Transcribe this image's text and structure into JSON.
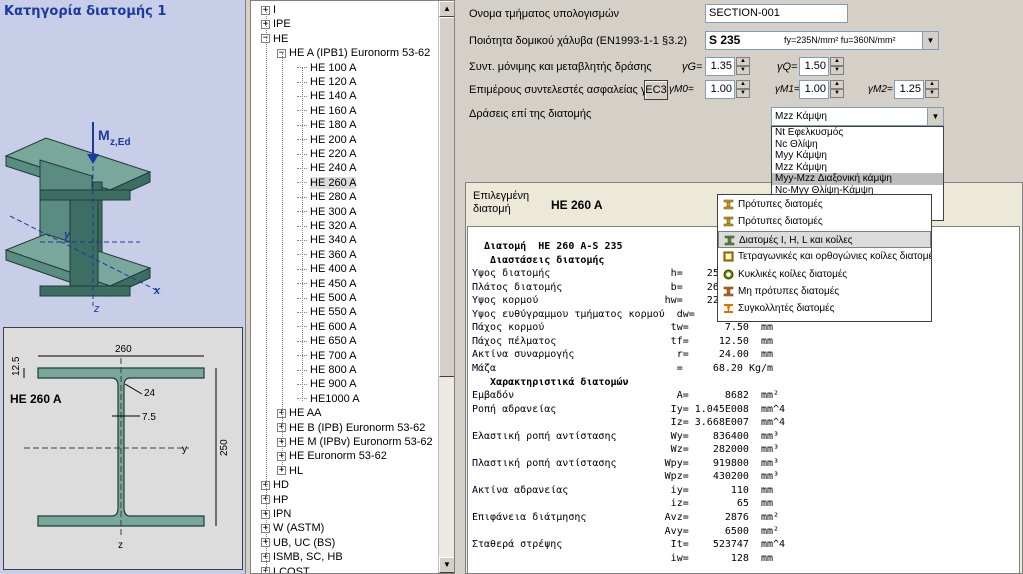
{
  "left": {
    "title": "Κατηγορία διατομής 1",
    "figure_labels": {
      "moment": "M",
      "moment_sub": "z,Ed",
      "y": "y",
      "z": "z",
      "x": "x"
    },
    "section": {
      "name": "HE 260 A",
      "width": "260",
      "height": "250",
      "flange": "12.5",
      "radius": "24",
      "web": "7.5",
      "y": "y",
      "z": "z"
    }
  },
  "tree": {
    "nodes": [
      {
        "label": "I",
        "level": 0,
        "box": "+"
      },
      {
        "label": "IPE",
        "level": 0,
        "box": "+"
      },
      {
        "label": "HE",
        "level": 0,
        "box": "−"
      },
      {
        "label": "HE A (IPB1)  Euronorm 53-62",
        "level": 1,
        "box": "−"
      },
      {
        "label": "HE 100 A",
        "level": 2
      },
      {
        "label": "HE 120 A",
        "level": 2
      },
      {
        "label": "HE 140 A",
        "level": 2
      },
      {
        "label": "HE 160 A",
        "level": 2
      },
      {
        "label": "HE 180 A",
        "level": 2
      },
      {
        "label": "HE 200 A",
        "level": 2
      },
      {
        "label": "HE 220 A",
        "level": 2
      },
      {
        "label": "HE 240 A",
        "level": 2
      },
      {
        "label": "HE 260 A",
        "level": 2,
        "selected": true
      },
      {
        "label": "HE 280 A",
        "level": 2
      },
      {
        "label": "HE 300 A",
        "level": 2
      },
      {
        "label": "HE 320 A",
        "level": 2
      },
      {
        "label": "HE 340 A",
        "level": 2
      },
      {
        "label": "HE 360 A",
        "level": 2
      },
      {
        "label": "HE 400 A",
        "level": 2
      },
      {
        "label": "HE 450 A",
        "level": 2
      },
      {
        "label": "HE 500 A",
        "level": 2
      },
      {
        "label": "HE 550 A",
        "level": 2
      },
      {
        "label": "HE 600 A",
        "level": 2
      },
      {
        "label": "HE 650 A",
        "level": 2
      },
      {
        "label": "HE 700 A",
        "level": 2
      },
      {
        "label": "HE 800 A",
        "level": 2
      },
      {
        "label": "HE 900 A",
        "level": 2
      },
      {
        "label": "HE1000 A",
        "level": 2
      },
      {
        "label": "HE AA",
        "level": 1,
        "box": "+"
      },
      {
        "label": "HE B (IPB)  Euronorm 53-62",
        "level": 1,
        "box": "+"
      },
      {
        "label": "HE M (IPBv)  Euronorm 53-62",
        "level": 1,
        "box": "+"
      },
      {
        "label": "HE  Euronorm 53-62",
        "level": 1,
        "box": "+"
      },
      {
        "label": "HL",
        "level": 1,
        "box": "+"
      },
      {
        "label": "HD",
        "level": 0,
        "box": "+"
      },
      {
        "label": "HP",
        "level": 0,
        "box": "+"
      },
      {
        "label": "IPN",
        "level": 0,
        "box": "+"
      },
      {
        "label": "W (ASTM)",
        "level": 0,
        "box": "+"
      },
      {
        "label": "UB, UC (BS)",
        "level": 0,
        "box": "+"
      },
      {
        "label": "ISMB, SC, HB",
        "level": 0,
        "box": "+"
      },
      {
        "label": "LCOST",
        "level": 0,
        "box": "+"
      }
    ]
  },
  "form": {
    "section_name_label": "Ονομα τμήματος υπολογισμών",
    "section_name_value": "SECTION-001",
    "steel_label": "Ποιότητα δομικού χάλυβα (EN1993-1-1 §3.2)",
    "steel_value": "S 235",
    "steel_props": "fy=235N/mm² fu=360N/mm²",
    "factors_label": "Συντ. μόνιμης και μεταβλητής δράσης",
    "gamma_g_label": "γG=",
    "gamma_g_value": "1.35",
    "gamma_q_label": "γQ=",
    "gamma_q_value": "1.50",
    "partial_label": "Επιμέρους συντελεστές ασφαλείας γι",
    "ec3_button": "EC3",
    "gm0_label": "γM0=",
    "gm0_value": "1.00",
    "gm1_label": "γM1=",
    "gm1_value": "1.00",
    "gm2_label": "γM2=",
    "gm2_value": "1.25",
    "actions_label": "Δράσεις επί της διατομής",
    "actions_value": "Mzz Κάμψη",
    "actions_options": [
      "Nt Εφελκυσμός",
      "Nc Θλίψη",
      "Myy Κάμψη",
      "Mzz Κάμψη",
      "Myy-Mzz Διαξονική κάμψη",
      "Nc-Myy Θλίψη-Κάμψη",
      "Nc-Mzz Θλίψη-Κάμψη",
      "Nt-Myy Εφελκυσμός-Κάμψη"
    ],
    "actions_highlight_index": 4
  },
  "results": {
    "selected_label_1": "Επιλεγμένη",
    "selected_label_2": "διατομή",
    "selected_name": "HE 260 A",
    "lines": [
      {
        "t": "  Διατομή  HE 260 A-S 235",
        "b": true
      },
      {
        "t": "   Διαστάσεις διατομής",
        "b": true
      },
      {
        "t": "Υψος διατομής                    h=    250.00  mm"
      },
      {
        "t": "Πλάτος διατομής                  b=    260.00  mm"
      },
      {
        "t": "Υψος κορμού                     hw=    225.00  mm"
      },
      {
        "t": "Υψος ευθύγραμμου τμήματος κορμού  dw=    177.00  mm"
      },
      {
        "t": "Πάχος κορμού                     tw=      7.50  mm"
      },
      {
        "t": "Πάχος πέλματος                   tf=     12.50  mm"
      },
      {
        "t": "Ακτίνα συναρμογής                 r=     24.00  mm"
      },
      {
        "t": "Μάζα                              =     68.20 Kg/m"
      },
      {
        "t": "   Χαρακτηριστικά διατομών",
        "b": true
      },
      {
        "t": "Εμβαδόν                           A=      8682  mm²"
      },
      {
        "t": "Ροπή αδρανείας                   Iy= 1.045E008  mm^4"
      },
      {
        "t": "                                 Iz= 3.668E007  mm^4"
      },
      {
        "t": "Ελαστική ροπή αντίστασης         Wy=    836400  mm³"
      },
      {
        "t": "                                 Wz=    282000  mm³"
      },
      {
        "t": "Πλαστική ροπή αντίστασης        Wpy=    919800  mm³"
      },
      {
        "t": "                                Wpz=    430200  mm³"
      },
      {
        "t": "Ακτίνα αδρανείας                 iy=       110  mm"
      },
      {
        "t": "                                 iz=        65  mm"
      },
      {
        "t": "Επιφάνεια διάτμησης             Avz=      2876  mm²"
      },
      {
        "t": "                                Avy=      6500  mm²"
      },
      {
        "t": "Σταθερά στρέψης                  It=    523747  mm^4"
      },
      {
        "t": "                                 iw=       128  mm"
      }
    ]
  },
  "popup": {
    "items": [
      {
        "label": "Πρότυπες διατομές",
        "icon": "i-beam-icon",
        "color": "#e8a000"
      },
      {
        "label": "Πρότυπες διατομές",
        "icon": "i-beam-icon",
        "color": "#d0a000"
      },
      {
        "label": "Διατομές  I, H, L και κοίλες",
        "icon": "i-beam-icon",
        "color": "#5a8a2a"
      },
      {
        "label": "Τετραγωνικές και ορθογώνιες κοίλες διατομές",
        "icon": "rect-hollow-icon",
        "color": "#d0a000"
      },
      {
        "label": "Κυκλικές κοίλες διατομές",
        "icon": "circle-hollow-icon",
        "color": "#6a8a00"
      },
      {
        "label": "Μη πρότυπες διατομές",
        "icon": "i-beam-icon",
        "color": "#e06000"
      },
      {
        "label": "Συγκολλητές διατομές",
        "icon": "welded-icon",
        "color": "#e07000"
      }
    ],
    "highlight_index": 2
  },
  "colors": {
    "steel": "#3c6e64",
    "title": "#1a3aa0",
    "arrow": "#1a3aa0"
  }
}
